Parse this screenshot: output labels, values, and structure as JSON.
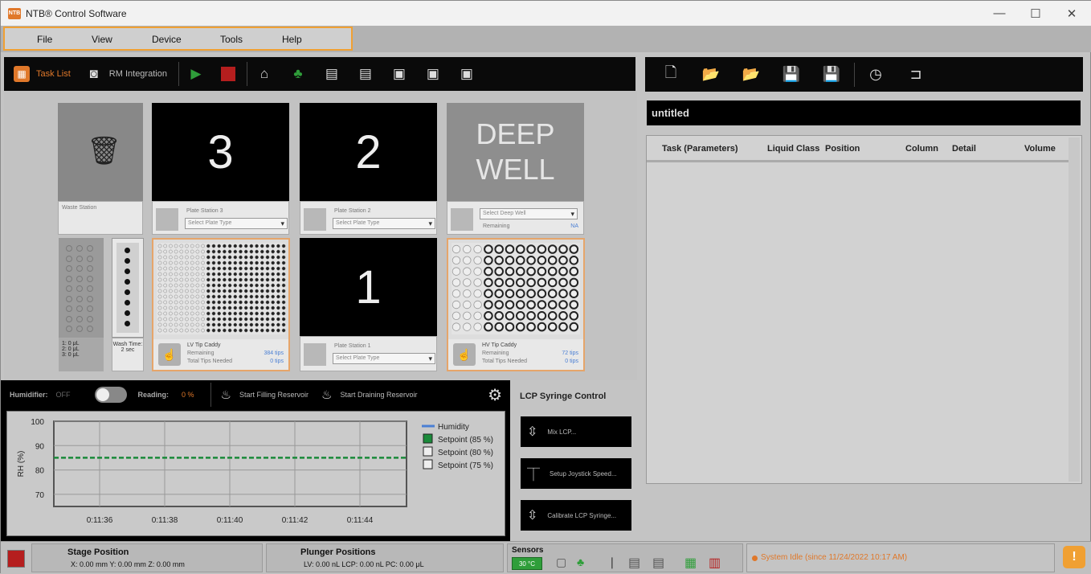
{
  "window": {
    "title": "NTB® Control Software",
    "minimize": "—",
    "maximize": "☐",
    "close": "✕"
  },
  "menu": {
    "items": [
      "File",
      "View",
      "Device",
      "Tools",
      "Help"
    ]
  },
  "toolbar": {
    "task_list": "Task List",
    "rm_integration": "RM Integration"
  },
  "deck": {
    "waste": {
      "label": "Waste Station"
    },
    "plate3": {
      "number": "3",
      "label": "Plate Station 3",
      "select": "Select Plate Type"
    },
    "plate2": {
      "number": "2",
      "label": "Plate Station 2",
      "select": "Select Plate Type"
    },
    "deepwell": {
      "line1": "DEEP",
      "line2": "WELL",
      "select": "Select Deep Well",
      "remaining": "Remaining",
      "remaining_value": "NA"
    },
    "plate1": {
      "number": "1",
      "label": "Plate Station 1",
      "select": "Select Plate Type"
    },
    "wash": {
      "vol1": "1: 0 μL",
      "vol2": "2: 0 μL",
      "vol3": "3: 0 μL",
      "time_label": "Wash Time:",
      "time_value": "2 sec"
    },
    "lv_caddy": {
      "title": "LV Tip Caddy",
      "remaining": "Remaining",
      "remaining_value": "384 tips",
      "needed": "Total Tips Needed",
      "needed_value": "0 tips"
    },
    "hv_caddy": {
      "title": "HV Tip Caddy",
      "remaining": "Remaining",
      "remaining_value": "72 tips",
      "needed": "Total Tips Needed",
      "needed_value": "0 tips"
    }
  },
  "humidifier": {
    "label": "Humidifier:",
    "state": "OFF",
    "reading_label": "Reading:",
    "reading_value": "0 %",
    "fill": "Start Filling Reservoir",
    "drain": "Start Draining Reservoir"
  },
  "chart_data": {
    "type": "line",
    "ylabel": "RH (%)",
    "yticks": [
      "100",
      "90",
      "80",
      "70"
    ],
    "ylim": [
      65,
      100
    ],
    "x": [
      "0:11:36",
      "0:11:38",
      "0:11:40",
      "0:11:42",
      "0:11:44"
    ],
    "series": [
      {
        "name": "Humidity",
        "values": [],
        "color": "#4a7fd4"
      },
      {
        "name": "Setpoint (85 %)",
        "values": [
          85,
          85,
          85,
          85,
          85
        ],
        "color": "#1a8a3a",
        "checked": true
      },
      {
        "name": "Setpoint (80 %)",
        "values": [],
        "checked": false
      },
      {
        "name": "Setpoint (75 %)",
        "values": [],
        "checked": false
      }
    ]
  },
  "lcp": {
    "title": "LCP Syringe Control",
    "mix": "Mix LCP...",
    "joystick": "Setup Joystick Speed...",
    "calibrate": "Calibrate LCP Syringe..."
  },
  "file": {
    "name": "untitled"
  },
  "task_table": {
    "headers": [
      "Task (Parameters)",
      "Liquid Class",
      "Position",
      "Column",
      "Detail",
      "Volume"
    ]
  },
  "status": {
    "stage_title": "Stage Position",
    "stage_value": "X: 0.00 mm   Y: 0.00 mm   Z: 0.00 mm",
    "plunger_title": "Plunger Positions",
    "plunger_value": "LV: 0.00 nL   LCP: 0.00 nL   PC: 0.00 μL",
    "sensors_title": "Sensors",
    "sensor_temp": "30 °C",
    "message": "System Idle (since 11/24/2022 10:17 AM)"
  },
  "colors": {
    "accent": "#f0a033",
    "play": "#2f9e3a",
    "stop": "#b51e1e",
    "tip_border": "#e6a56a"
  }
}
